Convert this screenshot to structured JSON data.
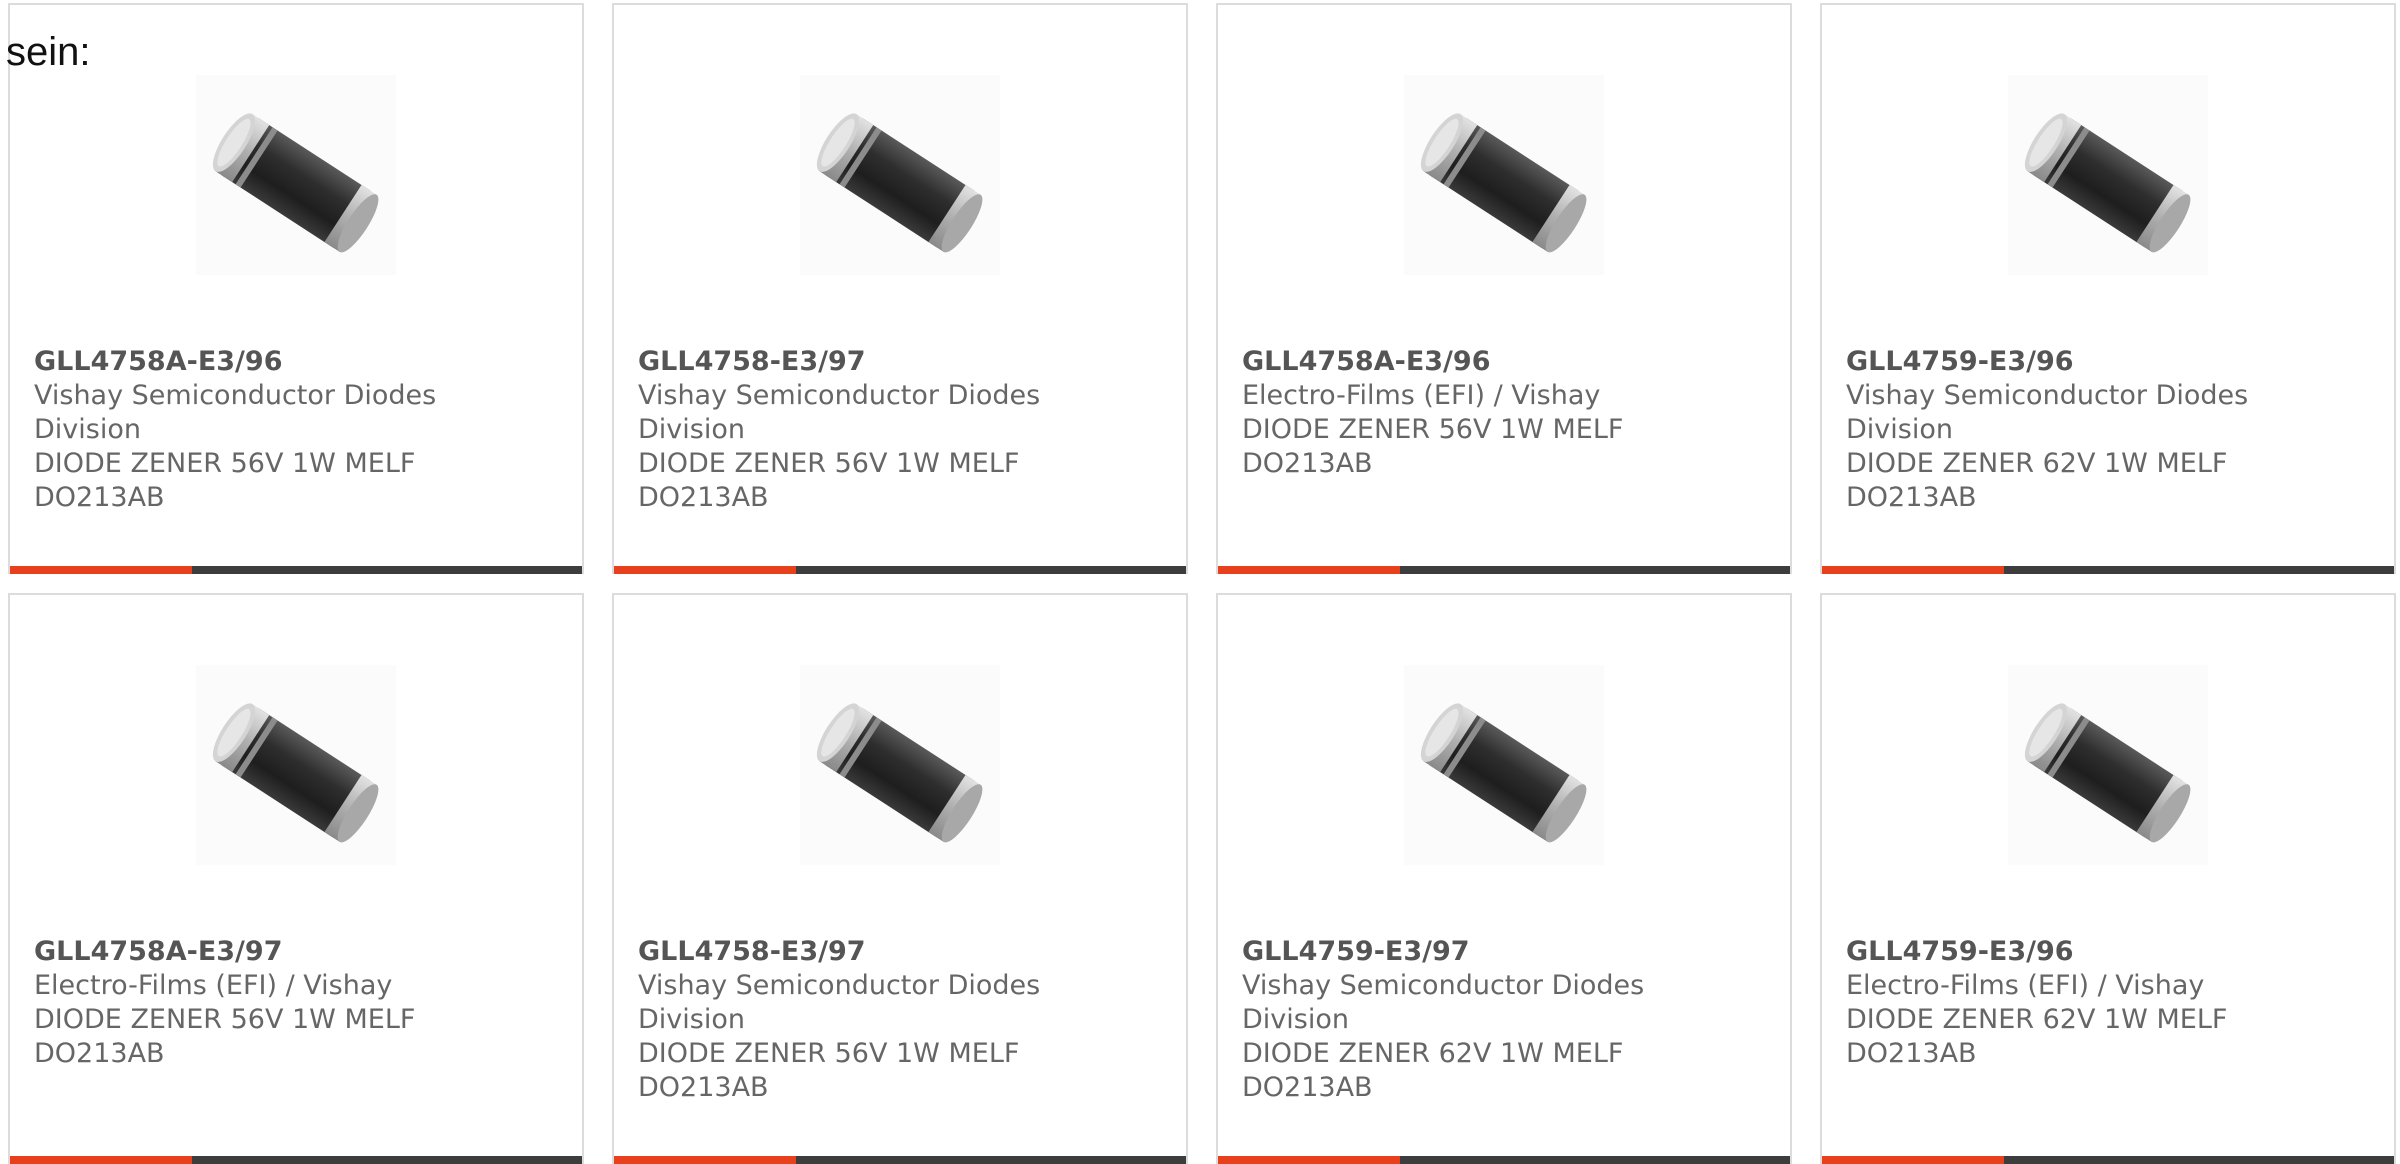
{
  "intro_text": "sein:",
  "colors": {
    "accent": "#e8401c",
    "bar": "#3d3d3d",
    "border": "#dcdcdc",
    "text": "#666666"
  },
  "products": [
    {
      "part_number": "GLL4758A-E3/96",
      "manufacturer": "Vishay Semiconductor Diodes Division",
      "description": "DIODE ZENER 56V 1W MELF DO213AB",
      "image_icon": "melf-diode-image"
    },
    {
      "part_number": "GLL4758-E3/97",
      "manufacturer": "Vishay Semiconductor Diodes Division",
      "description": "DIODE ZENER 56V 1W MELF DO213AB",
      "image_icon": "melf-diode-image"
    },
    {
      "part_number": "GLL4758A-E3/96",
      "manufacturer": "Electro-Films (EFI) / Vishay",
      "description": "DIODE ZENER 56V 1W MELF DO213AB",
      "image_icon": "melf-diode-image"
    },
    {
      "part_number": "GLL4759-E3/96",
      "manufacturer": "Vishay Semiconductor Diodes Division",
      "description": "DIODE ZENER 62V 1W MELF DO213AB",
      "image_icon": "melf-diode-image"
    },
    {
      "part_number": "GLL4758A-E3/97",
      "manufacturer": "Electro-Films (EFI) / Vishay",
      "description": "DIODE ZENER 56V 1W MELF DO213AB",
      "image_icon": "melf-diode-image"
    },
    {
      "part_number": "GLL4758-E3/97",
      "manufacturer": "Vishay Semiconductor Diodes Division",
      "description": "DIODE ZENER 56V 1W MELF DO213AB",
      "image_icon": "melf-diode-image"
    },
    {
      "part_number": "GLL4759-E3/97",
      "manufacturer": "Vishay Semiconductor Diodes Division",
      "description": "DIODE ZENER 62V 1W MELF DO213AB",
      "image_icon": "melf-diode-image"
    },
    {
      "part_number": "GLL4759-E3/96",
      "manufacturer": "Electro-Films (EFI) / Vishay",
      "description": "DIODE ZENER 62V 1W MELF DO213AB",
      "image_icon": "melf-diode-image"
    }
  ]
}
